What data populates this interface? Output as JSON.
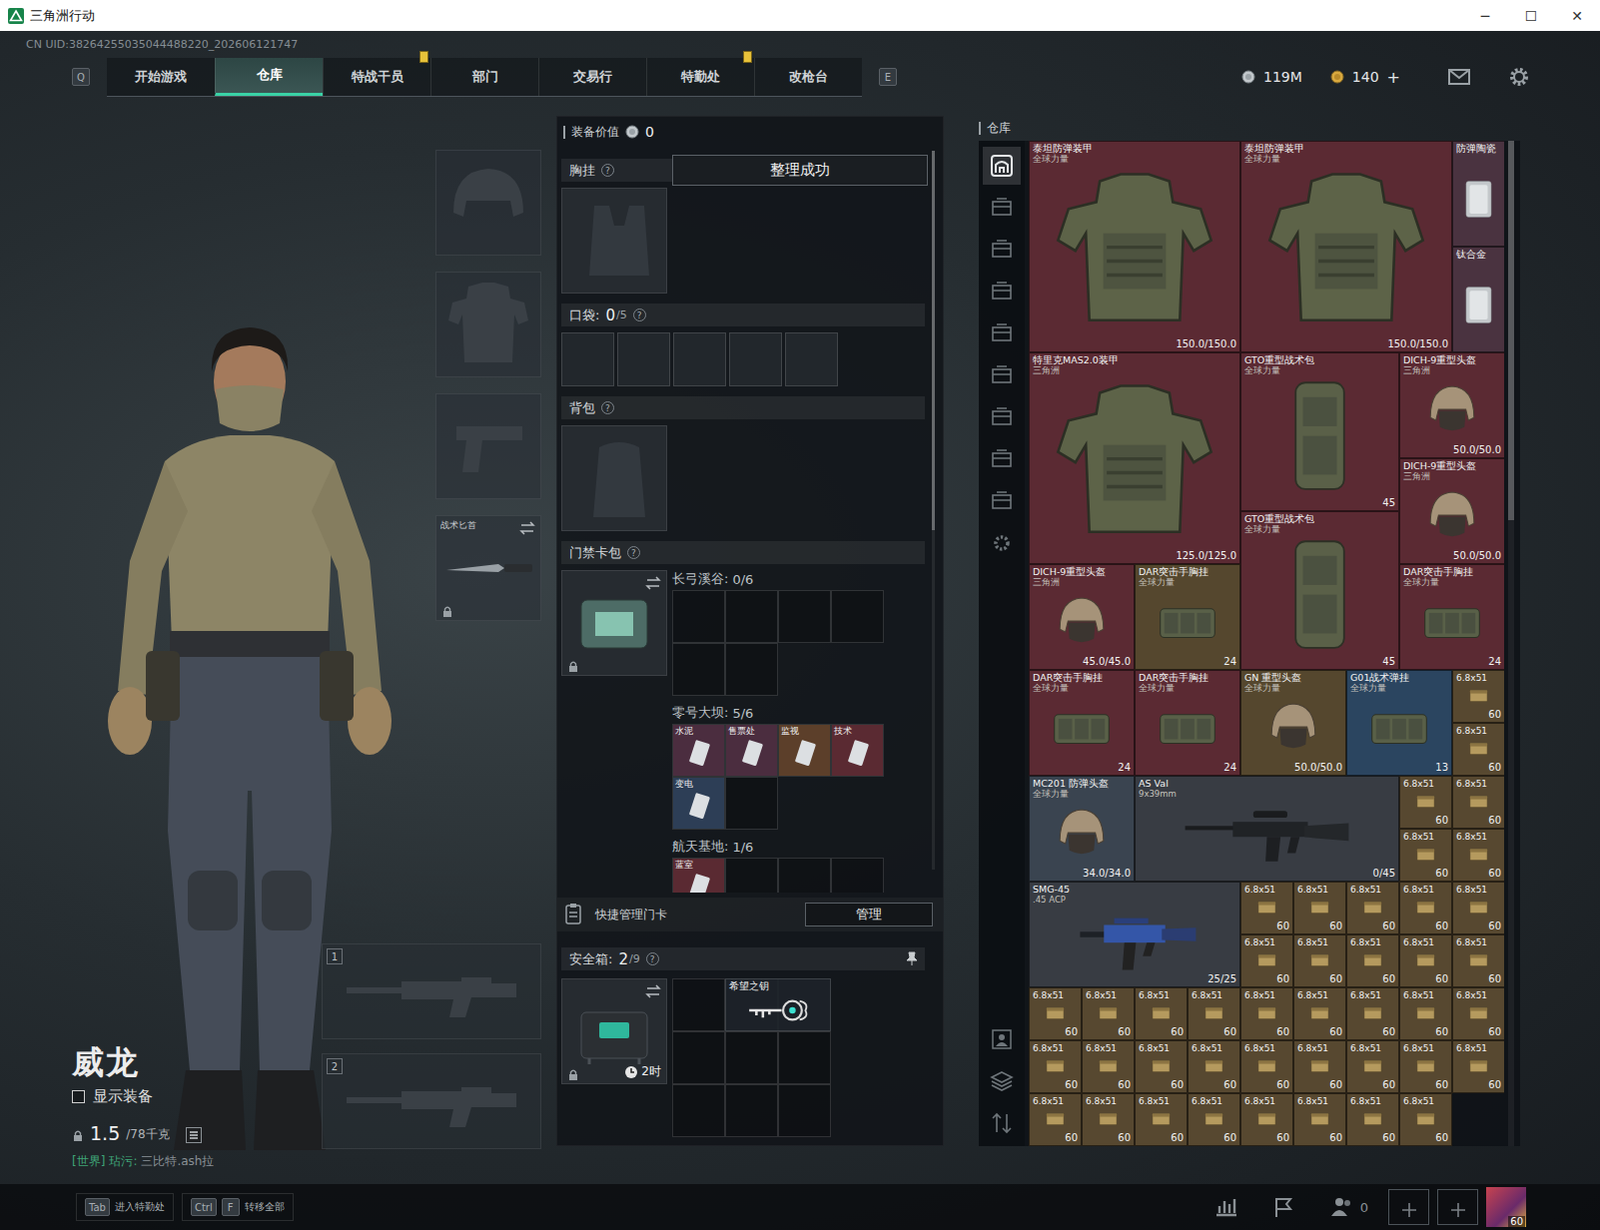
{
  "window": {
    "title": "三角洲行动",
    "controls": [
      "─",
      "☐",
      "✕"
    ]
  },
  "uid": "CN UID:38264255035044488220_202606121747",
  "nav": {
    "prev_key": "Q",
    "next_key": "E",
    "tabs": [
      {
        "label": "开始游戏",
        "selected": false,
        "alert": false
      },
      {
        "label": "仓库",
        "selected": true,
        "alert": false
      },
      {
        "label": "特战干员",
        "selected": false,
        "alert": true
      },
      {
        "label": "部门",
        "selected": false,
        "alert": false
      },
      {
        "label": "交易行",
        "selected": false,
        "alert": false
      },
      {
        "label": "特勤处",
        "selected": false,
        "alert": true
      },
      {
        "label": "改枪台",
        "selected": false,
        "alert": false
      }
    ]
  },
  "currency": {
    "coins": "119M",
    "tickets": "140",
    "add": "+"
  },
  "character": {
    "name": "威龙",
    "show_equipment": {
      "label": "显示装备",
      "checked": false
    },
    "weight": {
      "value": "1.5",
      "max": "/78千克"
    }
  },
  "equipment": [
    {
      "kind": "helmet"
    },
    {
      "kind": "armor"
    },
    {
      "kind": "pistol"
    },
    {
      "kind": "knife",
      "label": "战术匕首",
      "locked": true
    }
  ],
  "weapon_slots": [
    {
      "number": "1"
    },
    {
      "number": "2"
    }
  ],
  "chat": {
    "channel": "[世界]",
    "sender": "玷污:",
    "text": "三比特.ash拉"
  },
  "loadout": {
    "value_label": "装备价值",
    "value": "0",
    "toast": "整理成功",
    "chest": {
      "label": "胸挂",
      "help": "?"
    },
    "pockets": {
      "label": "口袋:",
      "count": "0",
      "capacity": "/5",
      "help": "?",
      "slots": 5
    },
    "backpack": {
      "label": "背包",
      "help": "?"
    },
    "keycards": {
      "label": "门禁卡包",
      "help": "?",
      "locked": true,
      "maps": [
        {
          "name": "长弓溪谷:",
          "count": "0/6",
          "slots": 6,
          "cards": []
        },
        {
          "name": "零号大坝:",
          "count": "5/6",
          "slots": 6,
          "cards": [
            {
              "name": "水泥",
              "color": "#4b2d3f"
            },
            {
              "name": "售票处",
              "color": "#4b2d3f"
            },
            {
              "name": "监视",
              "color": "#5c3f2a"
            },
            {
              "name": "技术",
              "color": "#5a2a32"
            },
            {
              "name": "变电",
              "color": "#2d3e56"
            }
          ]
        },
        {
          "name": "航天基地:",
          "count": "1/6",
          "slots": 6,
          "cards": [
            {
              "name": "蓝室",
              "color": "#5a2a32"
            }
          ]
        }
      ]
    },
    "quick_manage": {
      "label": "快捷管理门卡",
      "button": "管理"
    },
    "safe": {
      "label": "安全箱:",
      "count": "2",
      "capacity": "/9",
      "help": "?",
      "timer": "2时",
      "locked": true,
      "items": [
        {
          "name": "希望之钥"
        }
      ]
    }
  },
  "warehouse": {
    "title": "仓库",
    "tabs": [
      {
        "kind": "home",
        "selected": true
      },
      {
        "kind": "shelf",
        "selected": false
      },
      {
        "kind": "shelf",
        "selected": false
      },
      {
        "kind": "shelf",
        "selected": false
      },
      {
        "kind": "shelf",
        "selected": false
      },
      {
        "kind": "shelf",
        "selected": false
      },
      {
        "kind": "shelf",
        "selected": false
      },
      {
        "kind": "shelf",
        "selected": false
      },
      {
        "kind": "shelf",
        "selected": false
      },
      {
        "kind": "gear",
        "selected": false
      }
    ],
    "bottom_tabs": [
      {
        "kind": "person",
        "selected": false
      },
      {
        "kind": "layers",
        "selected": false
      },
      {
        "kind": "sort",
        "selected": false
      }
    ],
    "items": [
      {
        "name": "泰坦防弹装甲",
        "sub": "全球力量",
        "value": "150.0/150.0",
        "kind": "armor",
        "color": "#5b2a33"
      },
      {
        "name": "泰坦防弹装甲",
        "sub": "全球力量",
        "value": "150.0/150.0",
        "kind": "armor",
        "color": "#5b2a33"
      },
      {
        "name": "防弹陶瓷",
        "sub": "",
        "value": "",
        "kind": "plate",
        "color": "#4a3340"
      },
      {
        "name": "钛合金",
        "sub": "",
        "value": "",
        "kind": "plate",
        "color": "#4a3340"
      },
      {
        "name": "特里克MAS2.0装甲",
        "sub": "三角洲",
        "value": "125.0/125.0",
        "kind": "armor",
        "color": "#5b2a33"
      },
      {
        "name": "GTO重型战术包",
        "sub": "全球力量",
        "value": "45",
        "kind": "bag",
        "color": "#5b2a33"
      },
      {
        "name": "DICH-9重型头盔",
        "sub": "三角洲",
        "value": "50.0/50.0",
        "kind": "helmet",
        "color": "#5b2a33"
      },
      {
        "name": "DICH-9重型头盔",
        "sub": "三角洲",
        "value": "50.0/50.0",
        "kind": "helmet",
        "color": "#5b2a33"
      },
      {
        "name": "GTO重型战术包",
        "sub": "全球力量",
        "value": "45",
        "kind": "bag",
        "color": "#5b2a33"
      },
      {
        "name": "DICH-9重型头盔",
        "sub": "三角洲",
        "value": "45.0/45.0",
        "kind": "helmet",
        "color": "#5b2a33"
      },
      {
        "name": "DAR突击手胸挂",
        "sub": "全球力量",
        "value": "24",
        "kind": "rig",
        "color": "#55472e"
      },
      {
        "name": "DAR突击手胸挂",
        "sub": "全球力量",
        "value": "24",
        "kind": "rig",
        "color": "#5b2a33"
      },
      {
        "name": "DAR突击手胸挂",
        "sub": "全球力量",
        "value": "24",
        "kind": "rig",
        "color": "#5b2a33"
      },
      {
        "name": "DAR突击手胸挂",
        "sub": "全球力量",
        "value": "24",
        "kind": "rig",
        "color": "#5b2a33"
      },
      {
        "name": "GN 重型头盔",
        "sub": "全球力量",
        "value": "50.0/50.0",
        "kind": "helmet",
        "color": "#55472e"
      },
      {
        "name": "G01战术弹挂",
        "sub": "全球力量",
        "value": "13",
        "kind": "rig",
        "color": "#2b4560"
      },
      {
        "name": "MC201 防弹头盔",
        "sub": "全球力量",
        "value": "34.0/34.0",
        "kind": "helmet",
        "color": "#3a4450"
      },
      {
        "name": "AS Val",
        "sub": "9x39mm",
        "value": "0/45",
        "kind": "rifle",
        "color": "#383c43"
      },
      {
        "name": "SMG-45",
        "sub": ".45 ACP",
        "value": "25/25",
        "kind": "smg",
        "color": "#383c43"
      },
      {
        "name": "6.8x51",
        "sub": "",
        "value": "60",
        "kind": "ammo",
        "color": "#574830"
      },
      {
        "name": "6.8x51",
        "sub": "",
        "value": "60",
        "kind": "ammo",
        "color": "#574830"
      },
      {
        "name": "6.8x51",
        "sub": "",
        "value": "60",
        "kind": "ammo",
        "color": "#574830"
      },
      {
        "name": "6.8x51",
        "sub": "",
        "value": "60",
        "kind": "ammo",
        "color": "#574830"
      },
      {
        "name": "6.8x51",
        "sub": "",
        "value": "60",
        "kind": "ammo",
        "color": "#574830"
      },
      {
        "name": "6.8x51",
        "sub": "",
        "value": "60",
        "kind": "ammo",
        "color": "#574830"
      },
      {
        "name": "6.8x51",
        "sub": "",
        "value": "60",
        "kind": "ammo",
        "color": "#574830"
      },
      {
        "name": "6.8x51",
        "sub": "",
        "value": "60",
        "kind": "ammo",
        "color": "#574830"
      },
      {
        "name": "6.8x51",
        "sub": "",
        "value": "60",
        "kind": "ammo",
        "color": "#574830"
      },
      {
        "name": "6.8x51",
        "sub": "",
        "value": "60",
        "kind": "ammo",
        "color": "#574830"
      },
      {
        "name": "6.8x51",
        "sub": "",
        "value": "60",
        "kind": "ammo",
        "color": "#574830"
      },
      {
        "name": "6.8x51",
        "sub": "",
        "value": "60",
        "kind": "ammo",
        "color": "#574830"
      },
      {
        "name": "6.8x51",
        "sub": "",
        "value": "60",
        "kind": "ammo",
        "color": "#574830"
      },
      {
        "name": "6.8x51",
        "sub": "",
        "value": "60",
        "kind": "ammo",
        "color": "#574830"
      },
      {
        "name": "6.8x51",
        "sub": "",
        "value": "60",
        "kind": "ammo",
        "color": "#574830"
      },
      {
        "name": "6.8x51",
        "sub": "",
        "value": "60",
        "kind": "ammo",
        "color": "#574830"
      },
      {
        "name": "6.8x51",
        "sub": "",
        "value": "60",
        "kind": "ammo",
        "color": "#574830"
      },
      {
        "name": "6.8x51",
        "sub": "",
        "value": "60",
        "kind": "ammo",
        "color": "#574830"
      },
      {
        "name": "6.8x51",
        "sub": "",
        "value": "60",
        "kind": "ammo",
        "color": "#574830"
      },
      {
        "name": "6.8x51",
        "sub": "",
        "value": "60",
        "kind": "ammo",
        "color": "#574830"
      },
      {
        "name": "6.8x51",
        "sub": "",
        "value": "60",
        "kind": "ammo",
        "color": "#574830"
      },
      {
        "name": "6.8x51",
        "sub": "",
        "value": "60",
        "kind": "ammo",
        "color": "#574830"
      },
      {
        "name": "6.8x51",
        "sub": "",
        "value": "60",
        "kind": "ammo",
        "color": "#574830"
      },
      {
        "name": "6.8x51",
        "sub": "",
        "value": "60",
        "kind": "ammo",
        "color": "#574830"
      },
      {
        "name": "6.8x51",
        "sub": "",
        "value": "60",
        "kind": "ammo",
        "color": "#574830"
      },
      {
        "name": "6.8x51",
        "sub": "",
        "value": "60",
        "kind": "ammo",
        "color": "#574830"
      },
      {
        "name": "6.8x51",
        "sub": "",
        "value": "60",
        "kind": "ammo",
        "color": "#574830"
      },
      {
        "name": "6.8x51",
        "sub": "",
        "value": "60",
        "kind": "ammo",
        "color": "#574830"
      },
      {
        "name": "6.8x51",
        "sub": "",
        "value": "60",
        "kind": "ammo",
        "color": "#574830"
      },
      {
        "name": "6.8x51",
        "sub": "",
        "value": "60",
        "kind": "ammo",
        "color": "#574830"
      },
      {
        "name": "6.8x51",
        "sub": "",
        "value": "60",
        "kind": "ammo",
        "color": "#574830"
      },
      {
        "name": "6.8x51",
        "sub": "",
        "value": "60",
        "kind": "ammo",
        "color": "#574830"
      },
      {
        "name": "6.8x51",
        "sub": "",
        "value": "60",
        "kind": "ammo",
        "color": "#574830"
      },
      {
        "name": "6.8x51",
        "sub": "",
        "value": "60",
        "kind": "ammo",
        "color": "#574830"
      },
      {
        "name": "6.8x51",
        "sub": "",
        "value": "60",
        "kind": "ammo",
        "color": "#574830"
      },
      {
        "name": "6.8x51",
        "sub": "",
        "value": "60",
        "kind": "ammo",
        "color": "#574830"
      },
      {
        "name": "6.8x51",
        "sub": "",
        "value": "60",
        "kind": "ammo",
        "color": "#574830"
      },
      {
        "name": "6.8x51",
        "sub": "",
        "value": "60",
        "kind": "ammo",
        "color": "#574830"
      },
      {
        "name": "6.8x51",
        "sub": "",
        "value": "60",
        "kind": "ammo",
        "color": "#574830"
      },
      {
        "name": "6.8x51",
        "sub": "",
        "value": "60",
        "kind": "ammo",
        "color": "#574830"
      },
      {
        "name": "6.8x51",
        "sub": "",
        "value": "60",
        "kind": "ammo",
        "color": "#574830"
      },
      {
        "name": "6.8x51",
        "sub": "",
        "value": "60",
        "kind": "ammo",
        "color": "#574830"
      }
    ]
  },
  "bottom_bar": {
    "hints": [
      {
        "keys": [
          "Tab"
        ],
        "label": "进入特勤处"
      },
      {
        "keys": [
          "Ctrl",
          "F"
        ],
        "label": "转移全部"
      }
    ],
    "friends": "0",
    "level": "60"
  }
}
